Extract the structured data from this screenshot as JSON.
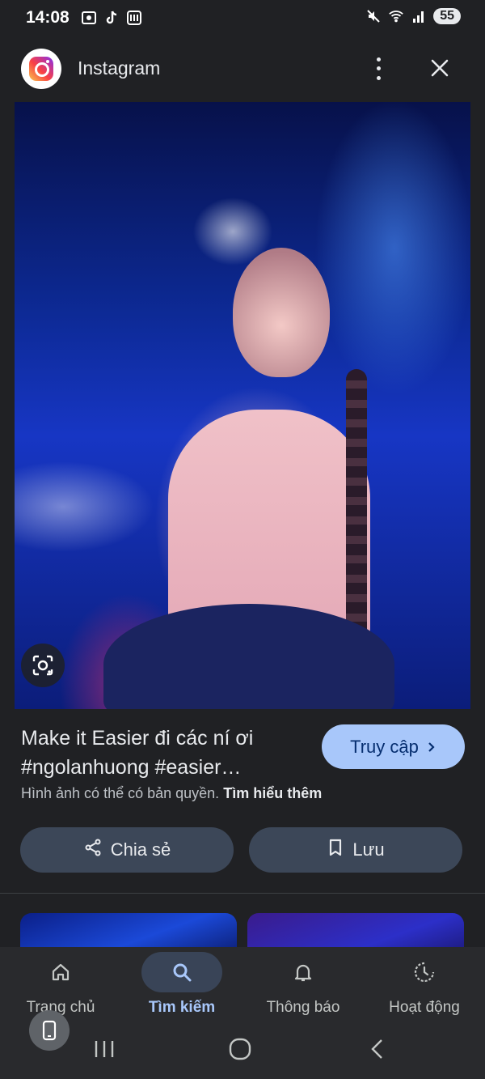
{
  "status_bar": {
    "time": "14:08",
    "battery": "55",
    "icons_left": [
      "screenshot-icon",
      "tiktok-icon",
      "gallery-icon"
    ],
    "icons_right": [
      "mute-icon",
      "wifi-icon",
      "signal-icon"
    ]
  },
  "app_bar": {
    "source_name": "Instagram",
    "more_icon": "more-vert-icon",
    "close_icon": "close-icon"
  },
  "image": {
    "lens_icon": "google-lens-icon"
  },
  "result": {
    "title_line1": "Make it Easier đi các ní ơi",
    "title_line2": "#ngolanhuong #easier…",
    "visit_label": "Truy cập",
    "copyright_text": "Hình ảnh có thể có bản quyền.",
    "learn_more": "Tìm hiểu thêm",
    "share_label": "Chia sẻ",
    "save_label": "Lưu"
  },
  "bottom_nav": {
    "items": [
      {
        "label": "Trang chủ",
        "icon": "home-icon",
        "active": false
      },
      {
        "label": "Tìm kiếm",
        "icon": "search-icon",
        "active": true
      },
      {
        "label": "Thông báo",
        "icon": "bell-icon",
        "active": false
      },
      {
        "label": "Hoạt động",
        "icon": "activity-icon",
        "active": false
      }
    ]
  },
  "colors": {
    "background": "#202124",
    "accent": "#a8c7fa",
    "pill": "#3c4758",
    "nav": "#292a2d"
  }
}
